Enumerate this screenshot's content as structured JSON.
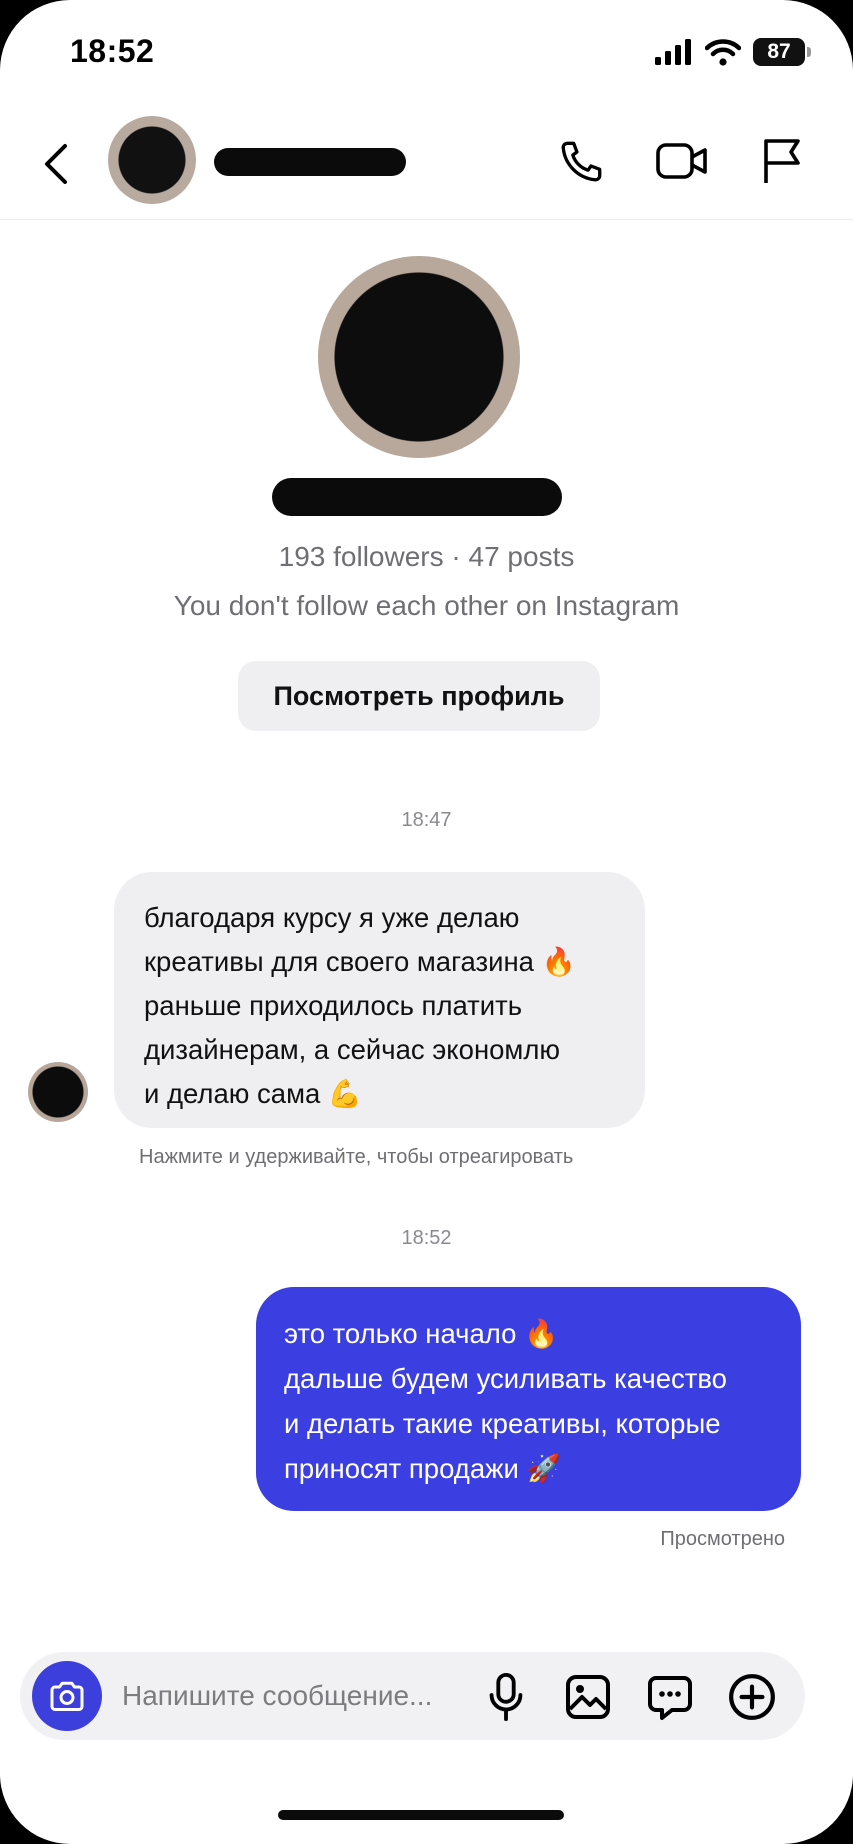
{
  "status_bar": {
    "time": "18:52",
    "battery": "87"
  },
  "profile": {
    "stats": "193 followers · 47 posts",
    "follow_status": "You don't follow each other on Instagram",
    "view_profile_label": "Посмотреть профиль"
  },
  "messages": [
    {
      "timestamp": "18:47",
      "direction": "incoming",
      "lines": [
        "благодаря курсу я уже делаю",
        "креативы для своего магазина 🔥",
        "раньше приходилось платить",
        "дизайнерам, а сейчас экономлю",
        "и делаю сама 💪"
      ],
      "hint": "Нажмите и удерживайте, чтобы отреагировать"
    },
    {
      "timestamp": "18:52",
      "direction": "outgoing",
      "lines": [
        "это только начало 🔥",
        "дальше будем усиливать качество",
        "и делать такие креативы, которые",
        "приносят продажи 🚀"
      ],
      "status": "Просмотрено"
    }
  ],
  "composer": {
    "placeholder": "Напишите сообщение..."
  },
  "colors": {
    "accent": "#3b3ee0",
    "incoming_bubble": "#efeff1",
    "secondary_text": "#6f6f73"
  },
  "icons": [
    "back-icon",
    "phone-icon",
    "video-icon",
    "flag-icon",
    "camera-icon",
    "microphone-icon",
    "gallery-icon",
    "sticker-icon",
    "plus-icon"
  ]
}
